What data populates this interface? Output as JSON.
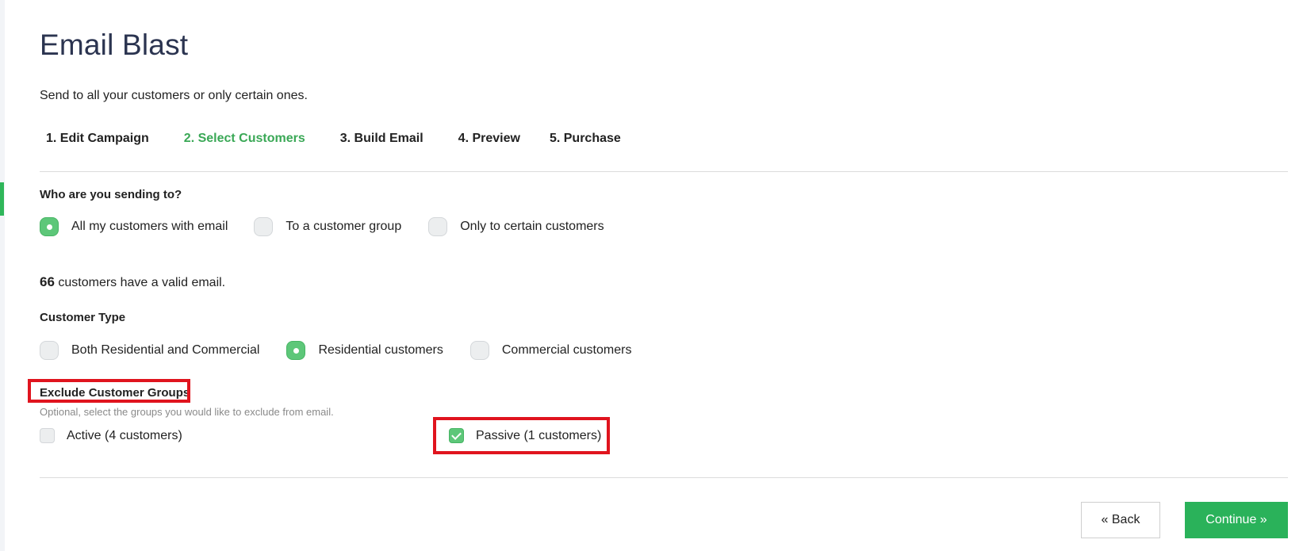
{
  "page": {
    "title": "Email Blast",
    "subtitle": "Send to all your customers or only certain ones."
  },
  "steps": [
    {
      "label": "1. Edit Campaign",
      "active": false
    },
    {
      "label": "2. Select Customers",
      "active": true
    },
    {
      "label": "3. Build Email",
      "active": false
    },
    {
      "label": "4. Preview",
      "active": false
    },
    {
      "label": "5. Purchase",
      "active": false
    }
  ],
  "recipients": {
    "label": "Who are you sending to?",
    "options": [
      {
        "label": "All my customers with email",
        "selected": true
      },
      {
        "label": "To a customer group",
        "selected": false
      },
      {
        "label": "Only to certain customers",
        "selected": false
      }
    ]
  },
  "valid_email": {
    "count": "66",
    "text": " customers have a valid email."
  },
  "customer_type": {
    "label": "Customer Type",
    "options": [
      {
        "label": "Both Residential and Commercial",
        "selected": false
      },
      {
        "label": "Residential customers",
        "selected": true
      },
      {
        "label": "Commercial customers",
        "selected": false
      }
    ]
  },
  "exclude_groups": {
    "label": "Exclude Customer Groups",
    "hint": "Optional, select the groups you would like to exclude from email.",
    "groups": [
      {
        "label": "Active (4 customers)",
        "checked": false
      },
      {
        "label": "Passive (1 customers)",
        "checked": true
      }
    ]
  },
  "buttons": {
    "back": "« Back",
    "continue": "Continue »"
  },
  "colors": {
    "accent_green": "#2ab25a",
    "active_step": "#3aa856",
    "highlight_red": "#e0141e",
    "title": "#2b3450"
  }
}
